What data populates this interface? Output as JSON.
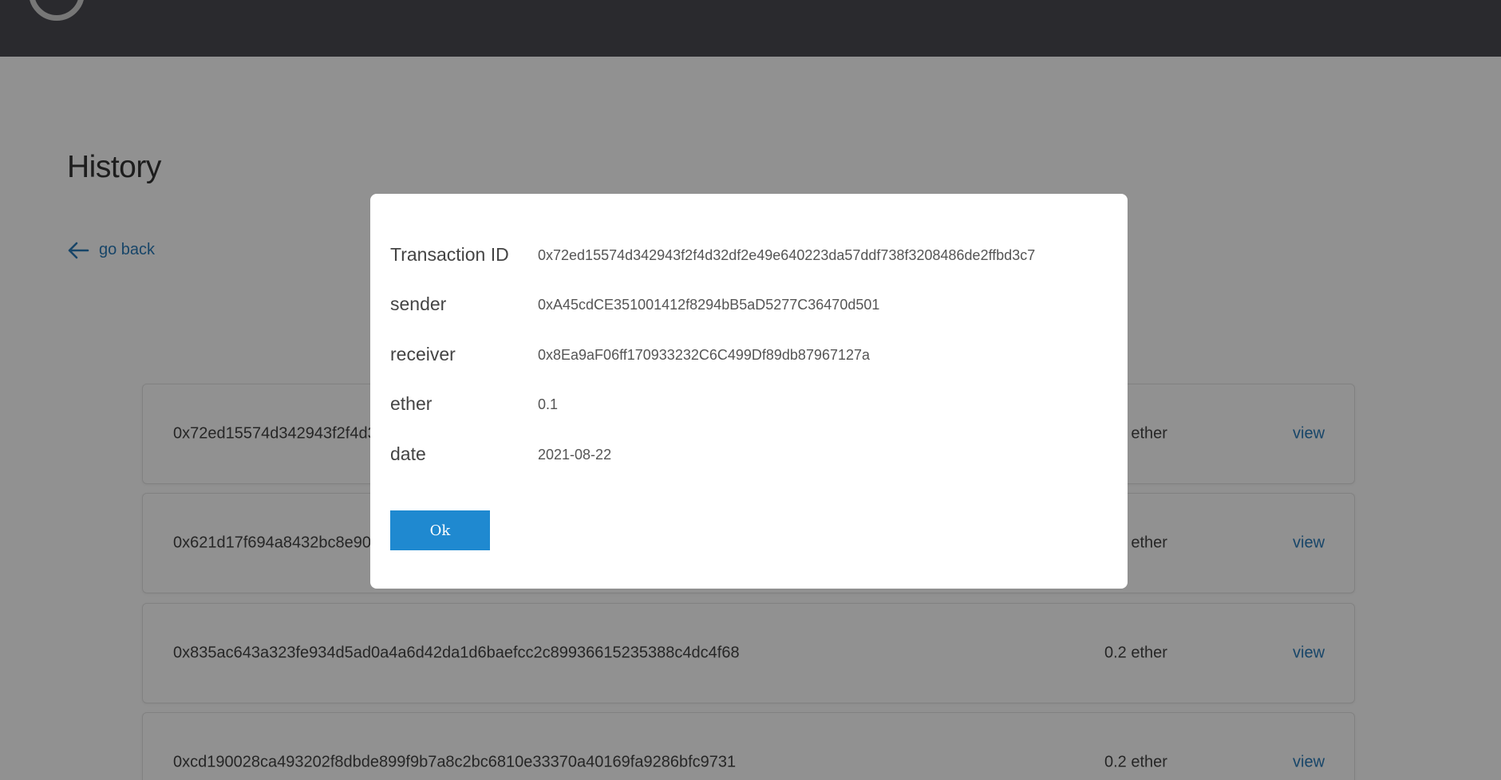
{
  "header": {
    "logo_icon": "steering-wheel-logo-icon"
  },
  "page": {
    "title": "History",
    "back_label": "go back"
  },
  "transactions": [
    {
      "hash": "0x72ed15574d342943f2f4d32df2e49e640223da57ddf738f3208486de2ffbd3c7",
      "amount": "0.1 ether",
      "action": "view"
    },
    {
      "hash": "0x621d17f694a8432bc8e90",
      "amount": "0.2 ether",
      "action": "view"
    },
    {
      "hash": "0x835ac643a323fe934d5ad0a4a6d42da1d6baefcc2c89936615235388c4dc4f68",
      "amount": "0.2 ether",
      "action": "view"
    },
    {
      "hash": "0xcd190028ca493202f8dbde899f9b7a8c2bc6810e33370a40169fa9286bfc9731",
      "amount": "0.2 ether",
      "action": "view"
    }
  ],
  "modal": {
    "fields": [
      {
        "label": "Transaction ID",
        "value": "0x72ed15574d342943f2f4d32df2e49e640223da57ddf738f3208486de2ffbd3c7"
      },
      {
        "label": "sender",
        "value": "0xA45cdCE351001412f8294bB5aD5277C36470d501"
      },
      {
        "label": "receiver",
        "value": "0x8Ea9aF06ff170933232C6C499Df89db87967127a"
      },
      {
        "label": "ether",
        "value": "0.1"
      },
      {
        "label": "date",
        "value": "2021-08-22"
      }
    ],
    "ok_label": "Ok"
  },
  "colors": {
    "header_bg": "#4a4a52",
    "link": "#2a7ab8",
    "primary_button": "#1f89d0"
  }
}
